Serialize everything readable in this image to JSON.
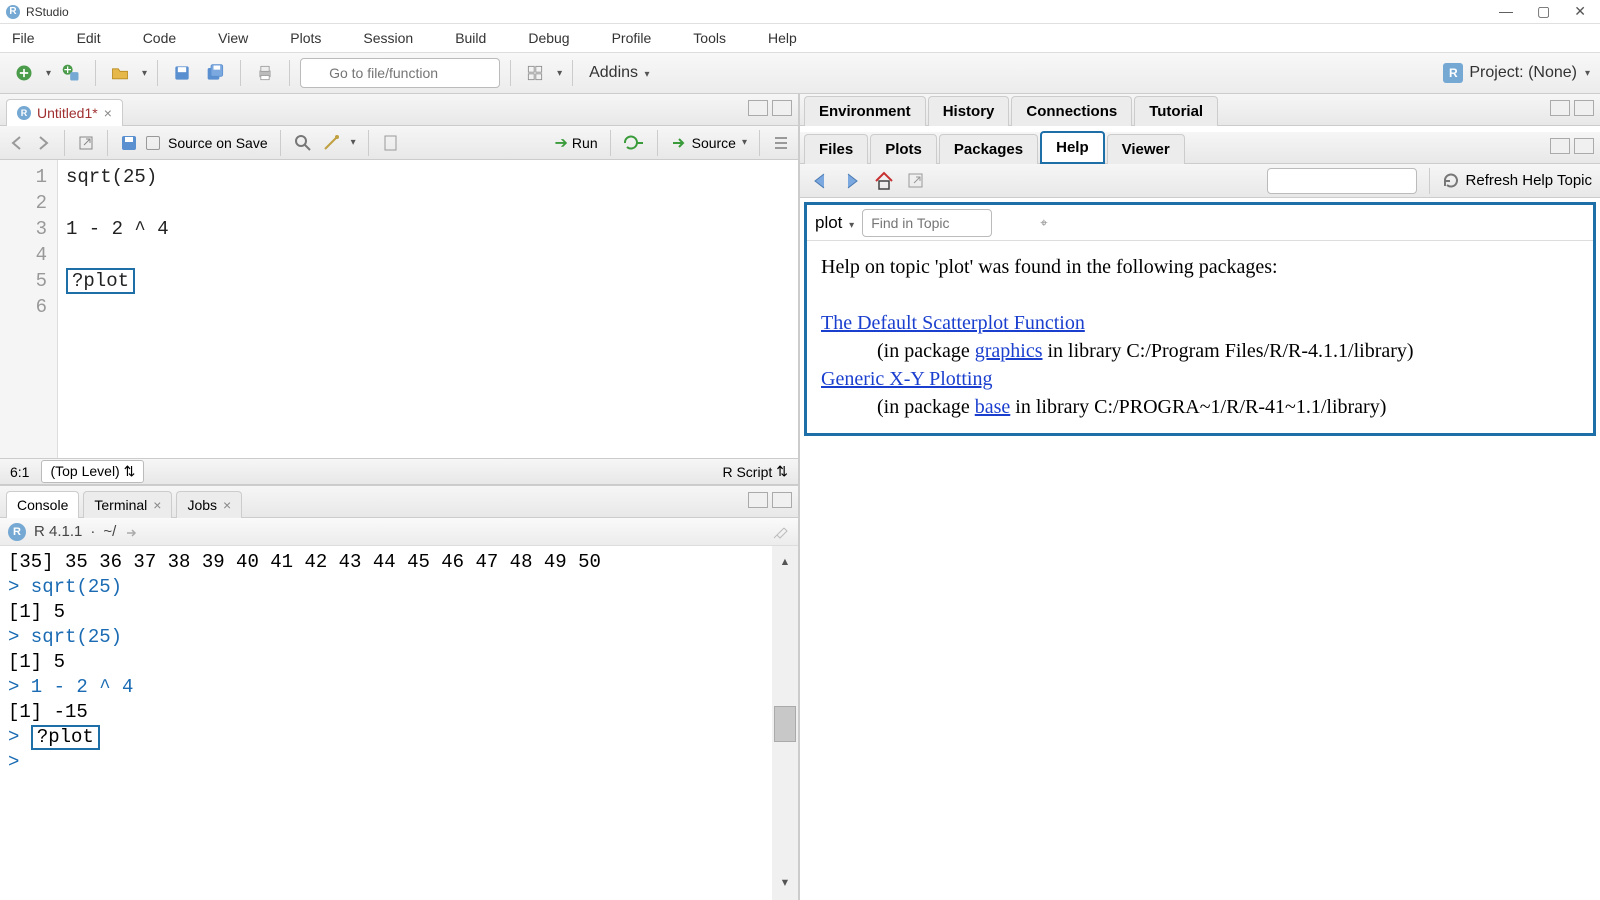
{
  "window": {
    "title": "RStudio"
  },
  "menu": [
    "File",
    "Edit",
    "Code",
    "View",
    "Plots",
    "Session",
    "Build",
    "Debug",
    "Profile",
    "Tools",
    "Help"
  ],
  "toolbar": {
    "goto_placeholder": "Go to file/function",
    "addins": "Addins",
    "project": "Project: (None)"
  },
  "source": {
    "tab_name": "Untitled1*",
    "source_on_save": "Source on Save",
    "run": "Run",
    "source_btn": "Source",
    "lines": [
      "sqrt(25)",
      "",
      "1 - 2 ^ 4",
      "",
      "?plot",
      ""
    ],
    "cursor": "6:1",
    "scope": "(Top Level)",
    "lang": "R Script"
  },
  "console": {
    "tabs": [
      "Console",
      "Terminal",
      "Jobs"
    ],
    "version": "R 4.1.1",
    "path": "~/",
    "lines": [
      "[35] 35 36 37 38 39 40 41 42 43 44 45 46 47 48 49 50",
      "> sqrt(25)",
      "[1] 5",
      "> sqrt(25)",
      "[1] 5",
      "> 1 - 2 ^ 4",
      "[1] -15",
      "> ?plot",
      "> "
    ]
  },
  "env_tabs": [
    "Environment",
    "History",
    "Connections",
    "Tutorial"
  ],
  "help_tabs": [
    "Files",
    "Plots",
    "Packages",
    "Help",
    "Viewer"
  ],
  "help": {
    "refresh": "Refresh Help Topic",
    "topic": "plot",
    "find_placeholder": "Find in Topic",
    "heading": "Help on topic 'plot' was found in the following packages:",
    "link1": "The Default Scatterplot Function",
    "pkg1a": "(in package ",
    "pkg1_link": "graphics",
    "pkg1b": " in library C:/Program Files/R/R-4.1.1/library)",
    "link2": "Generic X-Y Plotting",
    "pkg2a": "(in package ",
    "pkg2_link": "base",
    "pkg2b": " in library C:/PROGRA~1/R/R-41~1.1/library)"
  }
}
